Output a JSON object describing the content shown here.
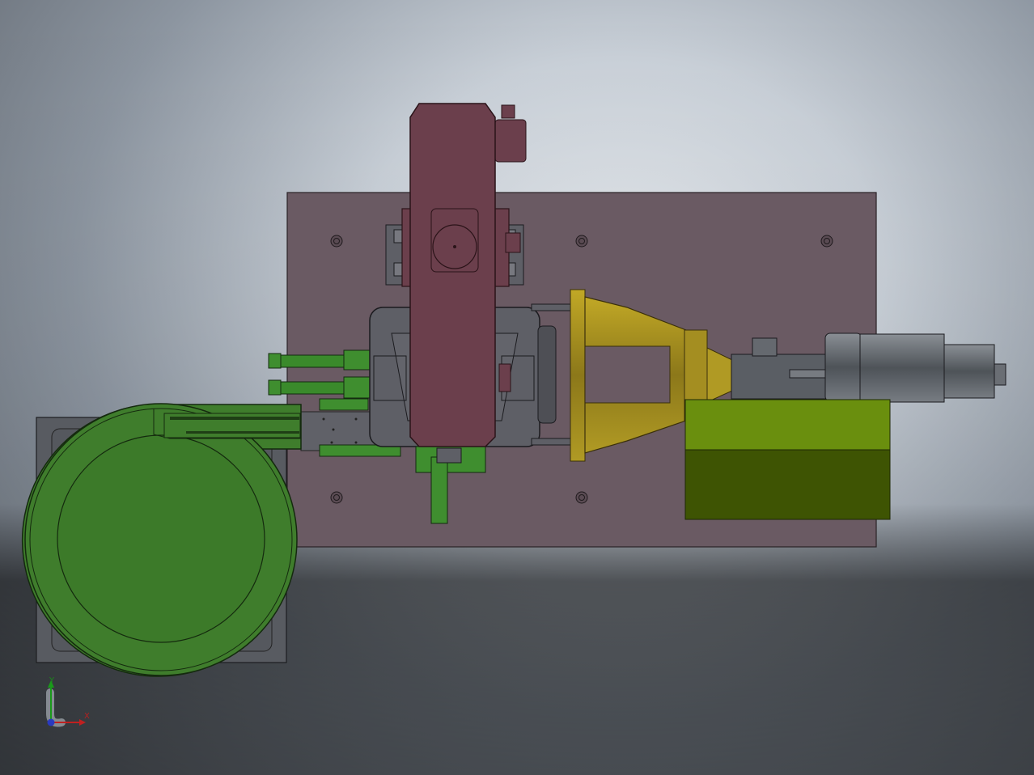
{
  "viewport": {
    "background_top": "#c9d0d8",
    "background_bottom": "#4a4e55"
  },
  "colors": {
    "baseplate": "#6a5a63",
    "housing": "#6b3f4c",
    "bowl": "#3f7d2c",
    "bowl_base": "#585b61",
    "gear_yellow": "#a48e21",
    "motor_gray": "#5f6469",
    "box_green": "#5f8515",
    "cylinder_green": "#3f8e2f",
    "frame_gray": "#5e5f66"
  },
  "triad": {
    "y_label": "Y",
    "x_label": "X",
    "icon": "coordinate-triad-icon"
  }
}
